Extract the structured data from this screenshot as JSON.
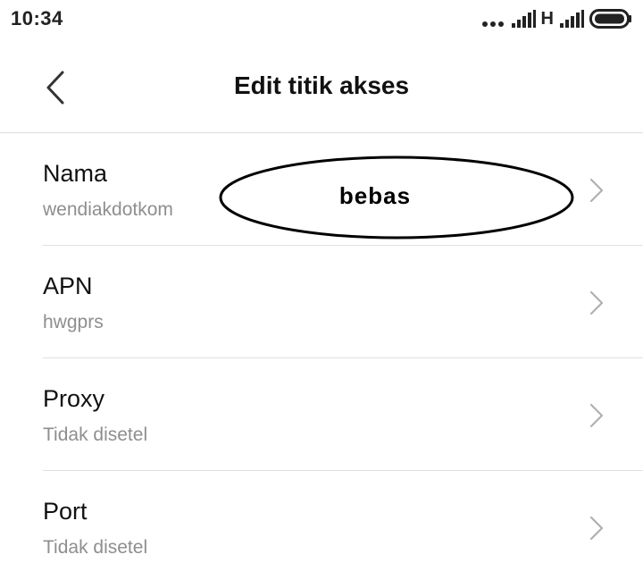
{
  "status_bar": {
    "time": "10:34",
    "network_type": "H",
    "icons": [
      "more-dots-icon",
      "signal-icon",
      "signal-icon",
      "battery-icon"
    ]
  },
  "header": {
    "title": "Edit titik akses",
    "back_icon": "chevron-left-icon"
  },
  "settings": [
    {
      "label": "Nama",
      "value": "wendiakdotkom"
    },
    {
      "label": "APN",
      "value": "hwgprs"
    },
    {
      "label": "Proxy",
      "value": "Tidak disetel"
    },
    {
      "label": "Port",
      "value": "Tidak disetel"
    }
  ],
  "annotation": {
    "text": "bebas"
  },
  "colors": {
    "text_primary": "#111111",
    "text_secondary": "#8e8e8e",
    "divider": "#e0e0e0",
    "chevron": "#b0b0b0"
  }
}
